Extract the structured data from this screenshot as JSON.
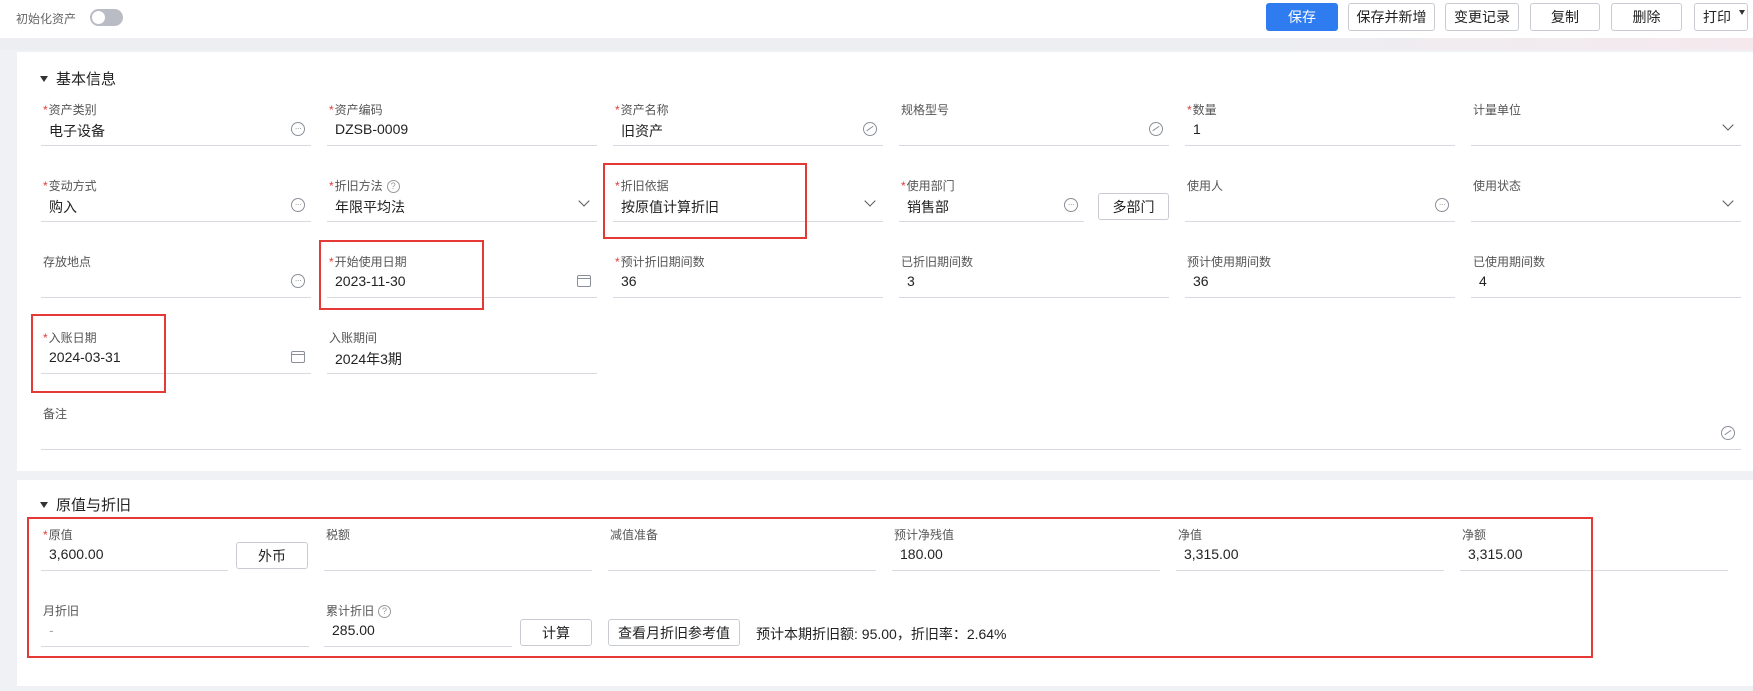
{
  "toolbar": {
    "init_label": "初始化资产",
    "buttons": [
      "保存",
      "保存并新增",
      "变更记录",
      "复制",
      "删除",
      "打印"
    ]
  },
  "basic": {
    "title": "基本信息",
    "fields": {
      "asset_category": {
        "label": "资产类别",
        "value": "电子设备"
      },
      "asset_code": {
        "label": "资产编码",
        "value": "DZSB-0009"
      },
      "asset_name": {
        "label": "资产名称",
        "value": "旧资产"
      },
      "spec_model": {
        "label": "规格型号",
        "value": ""
      },
      "quantity": {
        "label": "数量",
        "value": "1"
      },
      "unit": {
        "label": "计量单位",
        "value": ""
      },
      "change_method": {
        "label": "变动方式",
        "value": "购入"
      },
      "depr_method": {
        "label": "折旧方法",
        "value": "年限平均法"
      },
      "depr_basis": {
        "label": "折旧依据",
        "value": "按原值计算折旧"
      },
      "dept": {
        "label": "使用部门",
        "value": "销售部"
      },
      "user": {
        "label": "使用人",
        "value": ""
      },
      "use_status": {
        "label": "使用状态",
        "value": ""
      },
      "location": {
        "label": "存放地点",
        "value": ""
      },
      "start_date": {
        "label": "开始使用日期",
        "value": "2023-11-30"
      },
      "est_depr_periods": {
        "label": "预计折旧期间数",
        "value": "36"
      },
      "depr_periods_done": {
        "label": "已折旧期间数",
        "value": "3"
      },
      "est_use_periods": {
        "label": "预计使用期间数",
        "value": "36"
      },
      "used_periods": {
        "label": "已使用期间数",
        "value": "4"
      },
      "entry_date": {
        "label": "入账日期",
        "value": "2024-03-31"
      },
      "entry_period": {
        "label": "入账期间",
        "value": "2024年3期"
      },
      "remark": {
        "label": "备注",
        "value": ""
      }
    },
    "multi_dept_button": "多部门"
  },
  "depr": {
    "title": "原值与折旧",
    "fields": {
      "original_value": {
        "label": "原值",
        "value": "3,600.00"
      },
      "tax": {
        "label": "税额",
        "value": ""
      },
      "impairment": {
        "label": "减值准备",
        "value": ""
      },
      "est_residual": {
        "label": "预计净残值",
        "value": "180.00"
      },
      "net_value": {
        "label": "净值",
        "value": "3,315.00"
      },
      "net_amount": {
        "label": "净额",
        "value": "3,315.00"
      },
      "monthly_depr": {
        "label": "月折旧",
        "value": "-"
      },
      "accum_depr": {
        "label": "累计折旧",
        "value": "285.00"
      }
    },
    "foreign_button": "外币",
    "calc_button": "计算",
    "ref_button": "查看月折旧参考值",
    "info": "预计本期折旧额: 95.00，折旧率：2.64%"
  }
}
